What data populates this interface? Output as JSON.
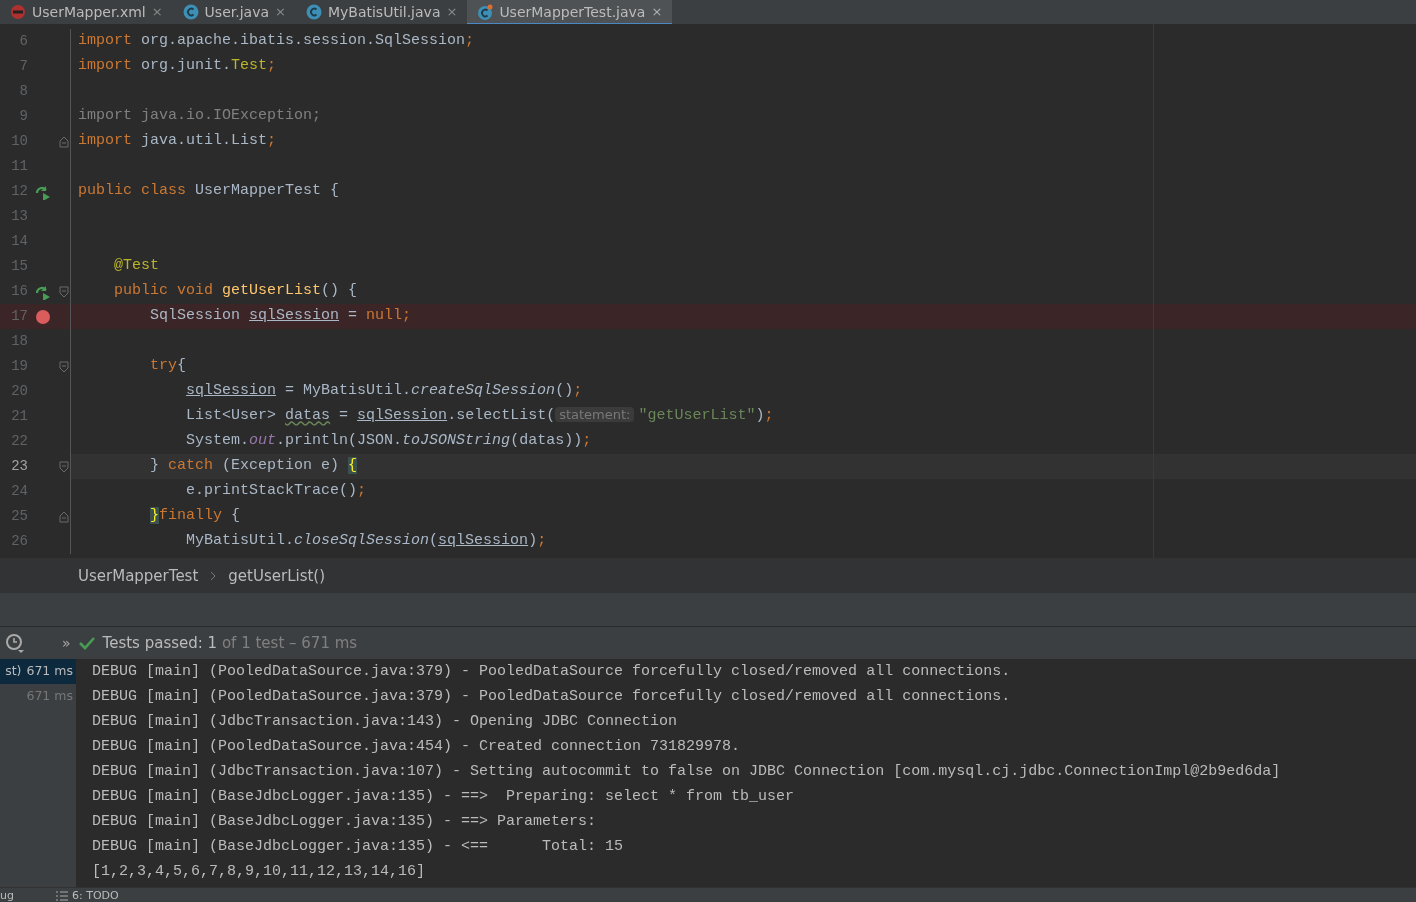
{
  "tabs": [
    {
      "label": "UserMapper.xml",
      "kind": "xml",
      "close": "×",
      "selected": false
    },
    {
      "label": "User.java",
      "kind": "class",
      "close": "×",
      "selected": false
    },
    {
      "label": "MyBatisUtil.java",
      "kind": "class",
      "close": "×",
      "selected": false
    },
    {
      "label": "UserMapperTest.java",
      "kind": "test",
      "close": "×",
      "selected": true
    }
  ],
  "editor": {
    "lines": [
      {
        "number": "6",
        "kind": "plain",
        "current": false,
        "tokens": [
          {
            "t": "import ",
            "kind": "kw"
          },
          {
            "t": "org.apache.ibatis.session.SqlSession",
            "kind": "id"
          },
          {
            "t": ";",
            "kind": "kw"
          }
        ]
      },
      {
        "number": "7",
        "kind": "plain",
        "current": false,
        "tokens": [
          {
            "t": "import ",
            "kind": "kw"
          },
          {
            "t": "org.junit.",
            "kind": "id"
          },
          {
            "t": "Test",
            "kind": "ann"
          },
          {
            "t": ";",
            "kind": "kw"
          }
        ]
      },
      {
        "number": "8",
        "kind": "plain",
        "current": false
      },
      {
        "number": "9",
        "kind": "plain",
        "current": false,
        "tokens": [
          {
            "t": "import java.io.IOException;",
            "kind": "dim"
          }
        ]
      },
      {
        "number": "10",
        "kind": "plain",
        "current": false,
        "fold_end": true,
        "tokens": [
          {
            "t": "import ",
            "kind": "kw"
          },
          {
            "t": "java.util.List",
            "kind": "id"
          },
          {
            "t": ";",
            "kind": "kw"
          }
        ]
      },
      {
        "number": "11",
        "kind": "plain",
        "current": false
      },
      {
        "number": "12",
        "kind": "run",
        "current": false,
        "tokens": [
          {
            "t": "public class ",
            "kind": "kw"
          },
          {
            "t": "UserMapperTest {",
            "kind": "id"
          }
        ]
      },
      {
        "number": "13",
        "kind": "plain",
        "current": false
      },
      {
        "number": "14",
        "kind": "plain",
        "current": false
      },
      {
        "number": "15",
        "kind": "plain",
        "current": false,
        "tokens": [
          {
            "t": "    @Test",
            "kind": "ann"
          }
        ]
      },
      {
        "number": "16",
        "kind": "run",
        "current": false,
        "fold_start": true,
        "tokens": [
          {
            "t": "    public void ",
            "kind": "kw"
          },
          {
            "t": "getUserList",
            "kind": "fn"
          },
          {
            "t": "() {",
            "kind": "id"
          }
        ]
      },
      {
        "number": "17",
        "kind": "breakpoint",
        "current": false,
        "tokens": [
          {
            "t": "        SqlSession ",
            "kind": "id"
          },
          {
            "t": "sqlSession",
            "kind": "var"
          },
          {
            "t": " = ",
            "kind": "id"
          },
          {
            "t": "null;",
            "kind": "kw"
          }
        ]
      },
      {
        "number": "18",
        "kind": "plain",
        "current": false
      },
      {
        "number": "19",
        "kind": "plain",
        "current": false,
        "fold_start": true,
        "tokens": [
          {
            "t": "        try",
            "kind": "kw"
          },
          {
            "t": "{",
            "kind": "id"
          }
        ]
      },
      {
        "number": "20",
        "kind": "plain",
        "current": false,
        "tokens": [
          {
            "t": "            sqlSession",
            "kind": "var"
          },
          {
            "t": " = MyBatisUtil.",
            "kind": "id"
          },
          {
            "t": "createSqlSession",
            "kind": "ital"
          },
          {
            "t": "()",
            "kind": "id"
          },
          {
            "t": ";",
            "kind": "kw"
          }
        ]
      },
      {
        "number": "21",
        "kind": "plain",
        "current": false,
        "tokens": [
          {
            "t": "            List<User> ",
            "kind": "id"
          },
          {
            "t": "datas",
            "kind": "warn"
          },
          {
            "t": " = ",
            "kind": "id"
          },
          {
            "t": "sqlSession",
            "kind": "var"
          },
          {
            "t": ".selectList(",
            "kind": "id"
          },
          {
            "t": "statement:",
            "kind": "hint"
          },
          {
            "t": "\"getUserList\"",
            "kind": "str"
          },
          {
            "t": ")",
            "kind": "id"
          },
          {
            "t": ";",
            "kind": "kw"
          }
        ]
      },
      {
        "number": "22",
        "kind": "plain",
        "current": false,
        "tokens": [
          {
            "t": "            System.",
            "kind": "id"
          },
          {
            "t": "out",
            "kind": "stat"
          },
          {
            "t": ".println(JSON.",
            "kind": "id"
          },
          {
            "t": "toJSONString",
            "kind": "ital"
          },
          {
            "t": "(datas))",
            "kind": "id"
          },
          {
            "t": ";",
            "kind": "kw"
          }
        ]
      },
      {
        "number": "23",
        "kind": "plain",
        "current": true,
        "fold_start": true,
        "tokens": [
          {
            "t": "        } ",
            "kind": "id"
          },
          {
            "t": "catch ",
            "kind": "kw"
          },
          {
            "t": "(Exception e) ",
            "kind": "id"
          },
          {
            "t": "{",
            "kind": "brace"
          }
        ]
      },
      {
        "number": "24",
        "kind": "plain",
        "current": false,
        "tokens": [
          {
            "t": "            e.printStackTrace()",
            "kind": "id"
          },
          {
            "t": ";",
            "kind": "kw"
          }
        ]
      },
      {
        "number": "25",
        "kind": "plain",
        "current": false,
        "fold_end": true,
        "tokens": [
          {
            "t": "        }",
            "kind": "brace"
          },
          {
            "t": "finally ",
            "kind": "kw"
          },
          {
            "t": "{",
            "kind": "id"
          }
        ]
      },
      {
        "number": "26",
        "kind": "plain",
        "current": false,
        "tokens": [
          {
            "t": "            MyBatisUtil.",
            "kind": "id"
          },
          {
            "t": "closeSqlSession",
            "kind": "ital"
          },
          {
            "t": "(",
            "kind": "id"
          },
          {
            "t": "sqlSession",
            "kind": "var"
          },
          {
            "t": ")",
            "kind": "id"
          },
          {
            "t": ";",
            "kind": "kw"
          }
        ]
      }
    ]
  },
  "breadcrumb": [
    "UserMapperTest",
    "getUserList()"
  ],
  "test_bar": {
    "expand": "»",
    "label": "Tests passed: ",
    "count": "1",
    "detail": "of 1 test – 671 ms"
  },
  "test_tree": [
    {
      "name": "st)",
      "time": "671 ms",
      "selected": true
    },
    {
      "time": "671 ms",
      "selected": false
    }
  ],
  "console": [
    "DEBUG [main] (PooledDataSource.java:379) - PooledDataSource forcefully closed/removed all connections.",
    "DEBUG [main] (PooledDataSource.java:379) - PooledDataSource forcefully closed/removed all connections.",
    "DEBUG [main] (JdbcTransaction.java:143) - Opening JDBC Connection",
    "DEBUG [main] (PooledDataSource.java:454) - Created connection 731829978.",
    "DEBUG [main] (JdbcTransaction.java:107) - Setting autocommit to false on JDBC Connection [com.mysql.cj.jdbc.ConnectionImpl@2b9ed6da]",
    "DEBUG [main] (BaseJdbcLogger.java:135) - ==>  Preparing: select * from tb_user",
    "DEBUG [main] (BaseJdbcLogger.java:135) - ==> Parameters: ",
    "DEBUG [main] (BaseJdbcLogger.java:135) - <==      Total: 15",
    "[1,2,3,4,5,6,7,8,9,10,11,12,13,14,16]"
  ],
  "status_tabs": [
    "ug",
    "6: TODO"
  ]
}
